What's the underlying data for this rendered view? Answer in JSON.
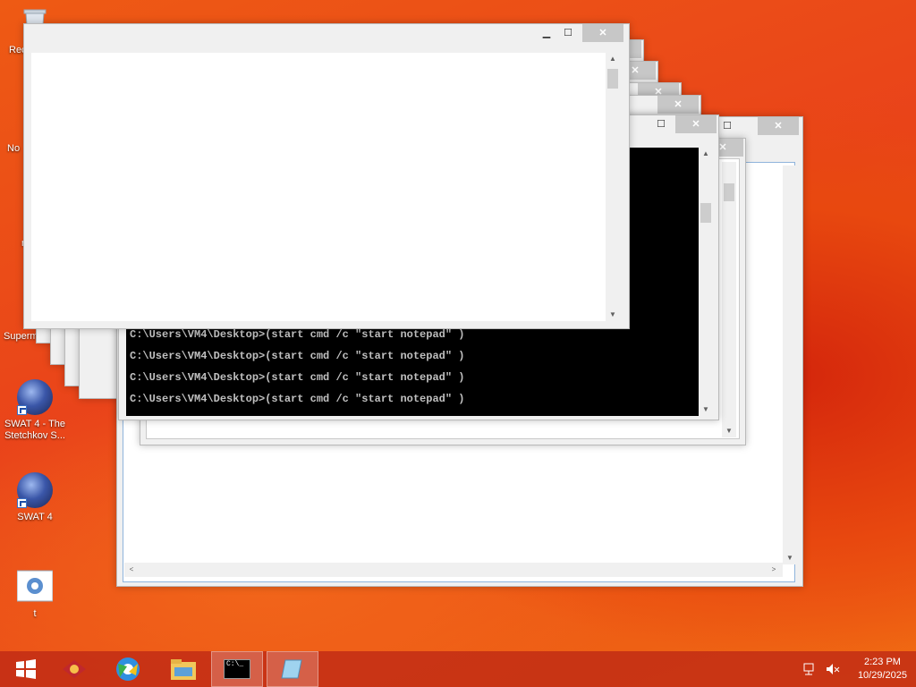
{
  "desktop": {
    "icons": [
      {
        "label": "Rec",
        "icon": "recycle-bin-icon"
      },
      {
        "label": "No",
        "icon": "notepad-shortcut-icon"
      },
      {
        "label": "n",
        "icon": "app-shortcut-icon"
      },
      {
        "label": "Supermi",
        "icon": "supermium-shortcut-icon"
      },
      {
        "label": "SWAT 4 - The Stetchkov S...",
        "icon": "swat4-expansion-icon"
      },
      {
        "label": "SWAT 4",
        "icon": "swat4-icon"
      },
      {
        "label": "t",
        "icon": "settings-file-icon"
      }
    ]
  },
  "windows": {
    "minimize_glyph": "▁",
    "maximize_glyph": "☐",
    "close_glyph": "✕",
    "scroll_up_glyph": "▲",
    "scroll_down_glyph": "▼",
    "scroll_left_glyph": "<",
    "scroll_right_glyph": ">"
  },
  "console": {
    "lines": [
      "C:\\Users\\VM4\\Desktop>(start cmd /c \"start notepad\" )",
      "C:\\Users\\VM4\\Desktop>(start cmd /c \"start notepad\" )",
      "C:\\Users\\VM4\\Desktop>(start cmd /c \"start notepad\" )",
      "C:\\Users\\VM4\\Desktop>(start cmd /c \"start notepad\" )"
    ]
  },
  "taskbar": {
    "items": [
      {
        "name": "start-button",
        "icon": "windows-logo-icon"
      },
      {
        "name": "taskbar-app-1",
        "icon": "app-icon"
      },
      {
        "name": "taskbar-browser",
        "icon": "browser-icon"
      },
      {
        "name": "taskbar-file-explorer",
        "icon": "folder-icon"
      },
      {
        "name": "taskbar-cmd",
        "icon": "cmd-icon",
        "label": "C:\\_"
      },
      {
        "name": "taskbar-notepad",
        "icon": "notepad-icon"
      }
    ],
    "tray": {
      "network_icon": "network-icon",
      "volume_icon": "volume-muted-icon",
      "time": "2:23 PM",
      "date": "10/29/2025"
    }
  }
}
